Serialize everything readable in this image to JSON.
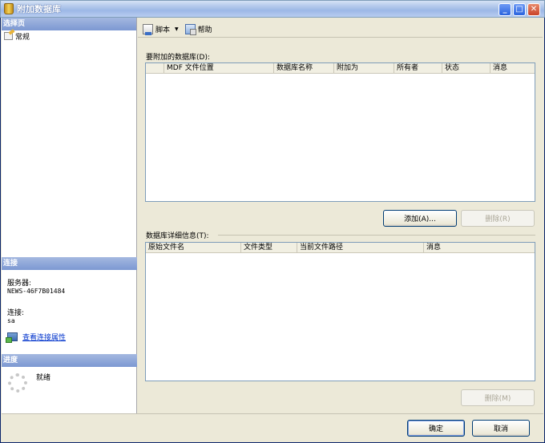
{
  "window": {
    "title": "附加数据库"
  },
  "left": {
    "select_page_header": "选择页",
    "pages": [
      {
        "label": "常规"
      }
    ],
    "connection": {
      "header": "连接",
      "server_label": "服务器:",
      "server_value": "NEWS-46F7B01484",
      "connection_label": "连接:",
      "connection_value": "sa",
      "view_properties_link": "查看连接属性"
    },
    "progress": {
      "header": "进度",
      "status": "就绪"
    }
  },
  "toolbar": {
    "script_label": "脚本",
    "help_label": "帮助"
  },
  "attach_section": {
    "label": "要附加的数据库(D):",
    "columns": [
      "MDF 文件位置",
      "数据库名称",
      "附加为",
      "所有者",
      "状态",
      "消息"
    ],
    "rows": [],
    "add_button": "添加(A)...",
    "remove_button": "删除(R)"
  },
  "details_section": {
    "label": "数据库详细信息(T):",
    "columns": [
      "原始文件名",
      "文件类型",
      "当前文件路径",
      "消息"
    ],
    "rows": [],
    "remove_button": "删除(M)"
  },
  "footer": {
    "ok_button": "确定",
    "cancel_button": "取消"
  }
}
